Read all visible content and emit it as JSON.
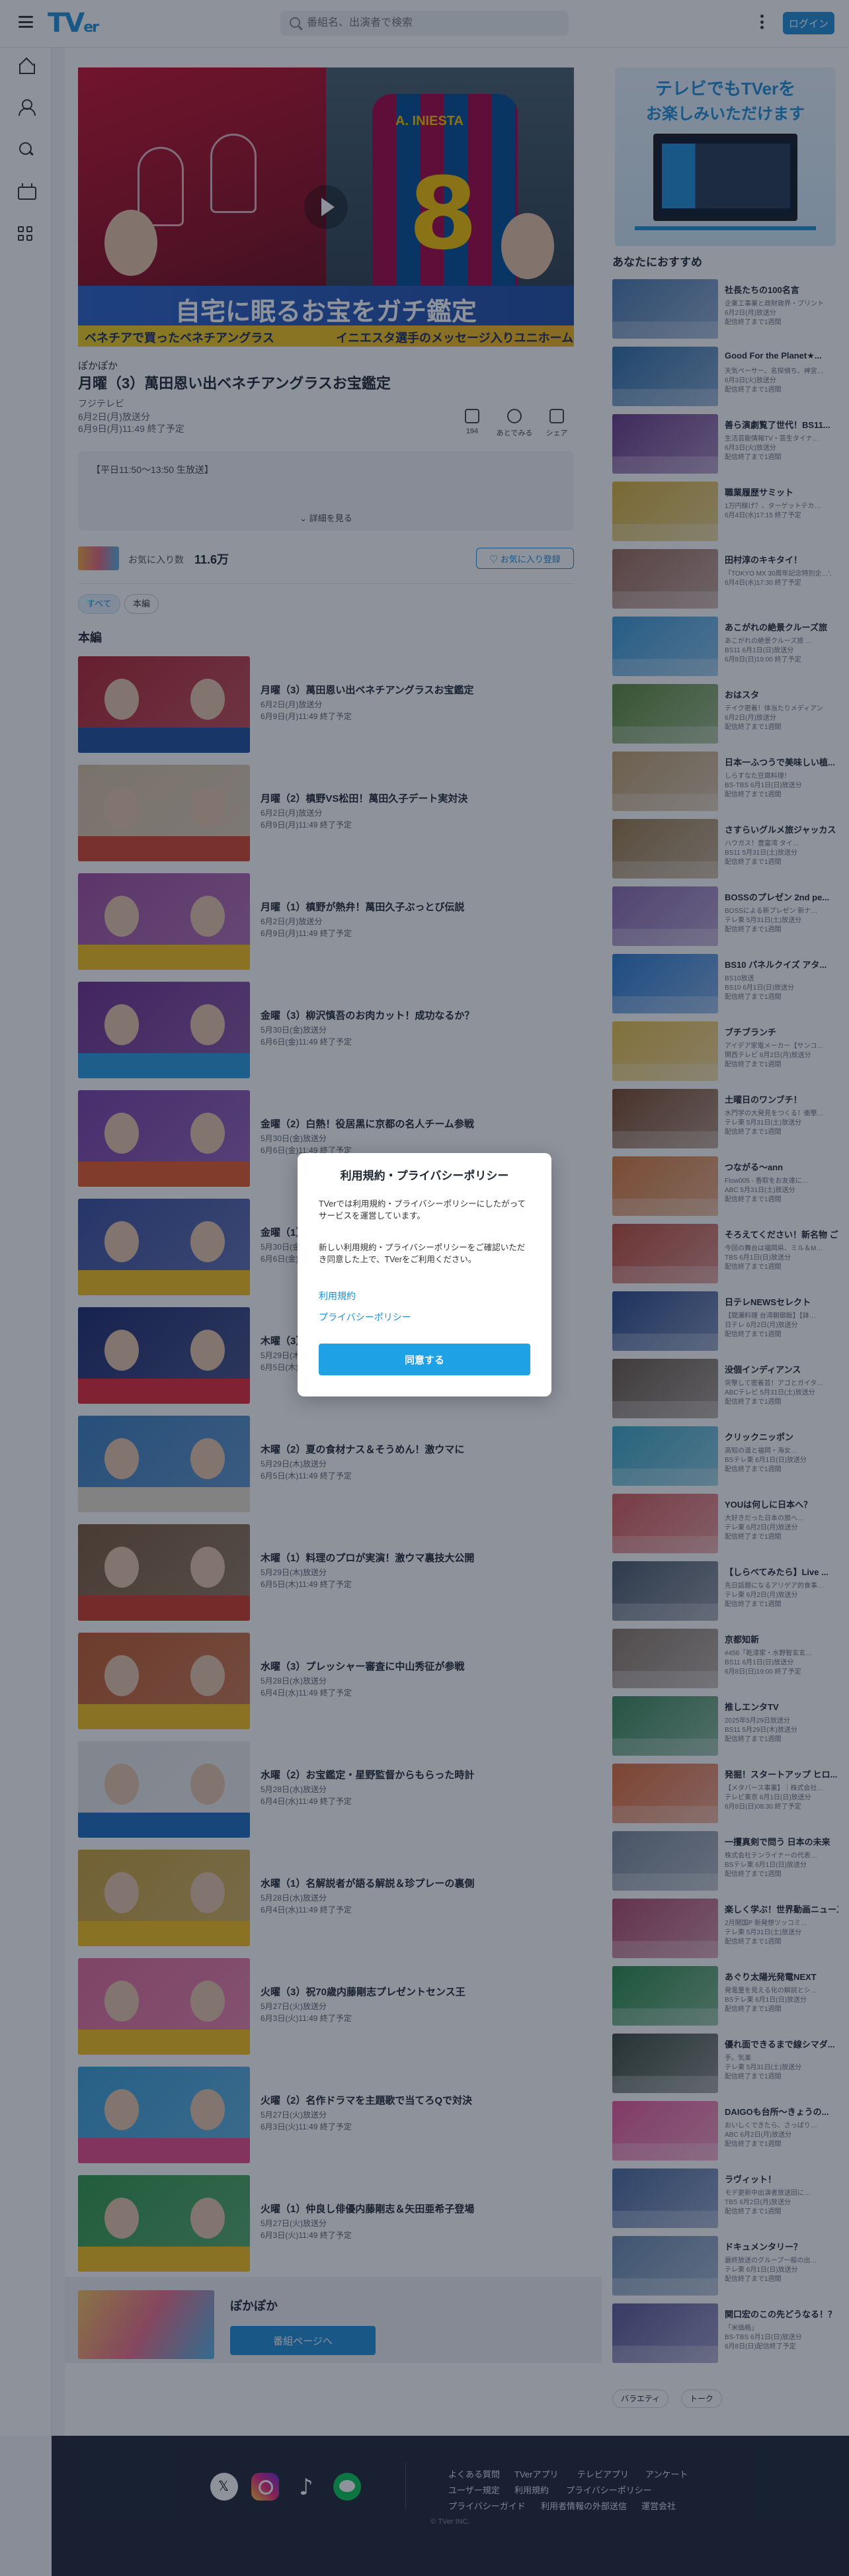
{
  "header": {
    "logo_main": "TV",
    "logo_sub": "er",
    "search_placeholder": "番組名、出演者で検索",
    "login_label": "ログイン"
  },
  "hero": {
    "overlay_text_left": "ベネチアで買ったベネチアングラス",
    "overlay_text_right": "イニエスタ選手のメッセージ入りユニホーム",
    "headline": "自宅に眠るお宝をガチ鑑定",
    "jersey_name": "A. INIESTA",
    "jersey_number": "8"
  },
  "episode": {
    "series": "ぽかぽか",
    "title": "月曜（3）萬田恩い出ベネチアングラスお宝鑑定",
    "broadcaster": "フジテレビ",
    "aired": "6月2日(月)放送分",
    "expires": "6月9日(月)11:49 終了予定",
    "description": "【平日11:50〜13:50 生放送】",
    "more_label": "詳細を見る",
    "actions": [
      {
        "label": "194"
      },
      {
        "label": "あとでみる"
      },
      {
        "label": "シェア"
      }
    ]
  },
  "favorites": {
    "label": "お気に入り数",
    "count": "11.6万",
    "button_label": "お気に入り登録"
  },
  "filters": {
    "all": "すべて",
    "main": "本編"
  },
  "section_title": "本編",
  "episodes": [
    {
      "title": "月曜（3）萬田恩い出ベネチアングラスお宝鑑定",
      "aired": "6月2日(月)放送分",
      "expires": "6月9日(月)11:49 終了予定"
    },
    {
      "title": "月曜（2）槙野VS松田！萬田久子デート実対決",
      "aired": "6月2日(月)放送分",
      "expires": "6月9日(月)11:49 終了予定"
    },
    {
      "title": "月曜（1）槙野が熱弁！萬田久子ぶっとび伝説",
      "aired": "6月2日(月)放送分",
      "expires": "6月9日(月)11:49 終了予定"
    },
    {
      "title": "金曜（3）柳沢慎吾のお肉カット！成功なるか？",
      "aired": "5月30日(金)放送分",
      "expires": "6月6日(金)11:49 終了予定"
    },
    {
      "title": "金曜（2）白熱！役居黒に京都の名人チーム参戦",
      "aired": "5月30日(金)放送分",
      "expires": "6月6日(金)11:49 終了予定"
    },
    {
      "title": "金曜（1）",
      "aired": "5月30日(金)放送分",
      "expires": "6月6日(金)11:49 終了予定"
    },
    {
      "title": "木曜（3）",
      "aired": "5月29日(木)放送分",
      "expires": "6月5日(木)11:49 終了予定"
    },
    {
      "title": "木曜（2）夏の食材ナス＆そうめん！激ウマに",
      "aired": "5月29日(木)放送分",
      "expires": "6月5日(木)11:49 終了予定"
    },
    {
      "title": "木曜（1）料理のプロが実演！激ウマ裏技大公開",
      "aired": "5月29日(木)放送分",
      "expires": "6月5日(木)11:49 終了予定"
    },
    {
      "title": "水曜（3）プレッシャー審査に中山秀征が参戦",
      "aired": "5月28日(水)放送分",
      "expires": "6月4日(水)11:49 終了予定"
    },
    {
      "title": "水曜（2）お宝鑑定・星野監督からもらった時計",
      "aired": "5月28日(水)放送分",
      "expires": "6月4日(水)11:49 終了予定"
    },
    {
      "title": "水曜（1）名解説者が語る解説＆珍プレーの裏側",
      "aired": "5月28日(水)放送分",
      "expires": "6月4日(水)11:49 終了予定"
    },
    {
      "title": "火曜（3）祝70歳内藤剛志プレゼントセンス王",
      "aired": "5月27日(火)放送分",
      "expires": "6月3日(火)11:49 終了予定"
    },
    {
      "title": "火曜（2）名作ドラマを主題歌で当てろQで対決",
      "aired": "5月27日(火)放送分",
      "expires": "6月3日(火)11:49 終了予定"
    },
    {
      "title": "火曜（1）仲良し俳優内藤剛志＆矢田亜希子登場",
      "aired": "5月27日(火)放送分",
      "expires": "6月3日(火)11:49 終了予定"
    }
  ],
  "series_card": {
    "name": "ぽかぽか",
    "button_label": "番組ページへ"
  },
  "promo": {
    "line1": "テレビでもTVerを",
    "line2": "お楽しみいただけます"
  },
  "side_title": "あなたにおすすめ",
  "recommended": [
    {
      "title": "社長たちの100名言",
      "sub": "企業工事業と政財政界・プリント",
      "d1": "6月2日(月)放送分",
      "d2": "配信終了まで1週間"
    },
    {
      "title": "Good For the Planet★...",
      "sub": "天気ペーサー、名探偵ち、神宮…",
      "d1": "6月3日(火)放送分",
      "d2": "配信終了まで1週間"
    },
    {
      "title": "善ら演劇覧了世代！BS11...",
      "sub": "生活芸能情報TV・芸生タイナ…",
      "d1": "6月3日(火)放送分",
      "d2": "配信終了まで1週間"
    },
    {
      "title": "職業履歴サミット",
      "sub": "1万円稼げ？、ターゲットテカ…",
      "d1": "6月4日(水)17:15 終了予定",
      "d2": ""
    },
    {
      "title": "田村淳のキキタイ！",
      "sub": "『TOKYO MX 30周年記念特別企…', ",
      "d1": "6月4日(水)17:30 終了予定",
      "d2": ""
    },
    {
      "title": "あこがれの絶景クルーズ旅",
      "sub": "あこがれの絶景クルーズ旅 …",
      "d1": "BS11 6月1日(日)放送分",
      "d2": "6月8日(日)19:00 終了予定"
    },
    {
      "title": "おはスタ",
      "sub": "テイク密着！体当たりメディアン",
      "d1": "6月2日(月)放送分",
      "d2": "配信終了まで1週間"
    },
    {
      "title": "日本一ふつうで美味しい植...",
      "sub": "しらすなた豆腐料理！",
      "d1": "BS-TBS 6月1日(日)放送分",
      "d2": "配信終了まで1週間"
    },
    {
      "title": "さすらいグルメ旅ジャッカス",
      "sub": "ハウガス！豊富湾 タイ…",
      "d1": "BS11 5月31日(土)放送分",
      "d2": "配信終了まで1週間"
    },
    {
      "title": "BOSSのプレゼン 2nd pe...",
      "sub": "BOSSによる新プレゼン 新ナ…",
      "d1": "テレ東 5月31日(土)放送分",
      "d2": "配信終了まで1週間"
    },
    {
      "title": "BS10 パネルクイズ アタ...",
      "sub": "BS10放送",
      "d1": "BS10 6月1日(日)放送分",
      "d2": "配信終了まで1週間"
    },
    {
      "title": "ブチブランチ",
      "sub": "アイデア家電メーカー【サンコ…",
      "d1": "関西テレビ 6月2日(月)放送分",
      "d2": "配信終了まで1週間"
    },
    {
      "title": "土曜日のワンブチ！",
      "sub": "水門学の大発見をつくる！衝撃…",
      "d1": "テレ東 5月31日(土)放送分",
      "d2": "配信終了まで1週間"
    },
    {
      "title": "つながる〜ann",
      "sub": "Flow005 - 香取をお友達に…",
      "d1": "ABC 5月31日(土)放送分",
      "d2": "配信終了まで1週間"
    },
    {
      "title": "そろえてください！新名物 ご...",
      "sub": "今回の舞台は福岡県、ミル＆M…",
      "d1": "TBS 6月1日(日)放送分",
      "d2": "配信終了まで1週間"
    },
    {
      "title": "日テレNEWSセレクト",
      "sub": "【間瀬料理 台湾朝御飯】【鉢…",
      "d1": "日テレ 6月2日(月)放送分",
      "d2": "配信終了まで1週間"
    },
    {
      "title": "没個インディアンス",
      "sub": "突撃して密着芸！アゴとガイタ…",
      "d1": "ABCテレビ 5月31日(土)放送分",
      "d2": "配信終了まで1週間"
    },
    {
      "title": "クリックニッポン",
      "sub": "高知の道と福岡・海女…",
      "d1": "BSテレ東 6月1日(日)放送分",
      "d2": "配信終了まで1週間"
    },
    {
      "title": "YOUは何しに日本へ？",
      "sub": "大好きだった日本の旅へ…",
      "d1": "テレ東 6月2日(月)放送分",
      "d2": "配信終了まで1週間"
    },
    {
      "title": "【しらべてみたら】Live ...",
      "sub": "先日話題になるアリゲア的食事…",
      "d1": "テレ東 6月2日(月)放送分",
      "d2": "配信終了まで1週間"
    },
    {
      "title": "京都知新",
      "sub": "#456「乾漆家・水野智玄玄…",
      "d1": "BS11 6月1日(日)放送分",
      "d2": "6月8日(日)19:00 終了予定"
    },
    {
      "title": "推しエンタTV",
      "sub": "2025年5月29日放送分",
      "d1": "BS11 5月29日(木)放送分",
      "d2": "配信終了まで1週間"
    },
    {
      "title": "発掘！スタートアップ ヒロ...",
      "sub": "【メタバース事業】｜株式会社…",
      "d1": "テレビ東京 6月1日(日)放送分",
      "d2": "6月8日(日)08:30 終了予定"
    },
    {
      "title": "一攫真剣で問う 日本の未来",
      "sub": "株式会社テンライナーの代表…",
      "d1": "BSテレ東 6月1日(日)放送分",
      "d2": "配信終了まで1週間"
    },
    {
      "title": "楽しく学ぶ！世界動画ニュース",
      "sub": "2月開国P 新発想ツッコミ…",
      "d1": "テレ東 5月31日(土)放送分",
      "d2": "配信終了まで1週間"
    },
    {
      "title": "あぐり太陽光発電NEXT",
      "sub": "発電量を見える化の解説とシ…",
      "d1": "BSテレ東 6月1日(日)放送分",
      "d2": "配信終了まで1週間"
    },
    {
      "title": "優れ面できるまで線シマダ...",
      "sub": "手。気楽",
      "d1": "テレ東 5月31日(土)放送分",
      "d2": "配信終了まで1週間"
    },
    {
      "title": "DAIGOも台所〜きょうの...",
      "sub": "おいしくできたら、さっぱり…",
      "d1": "ABC 6月2日(月)放送分",
      "d2": "配信終了まで1週間"
    },
    {
      "title": "ラヴィット！",
      "sub": "モデ更新中出演者放送回に…",
      "d1": "TBS 6月2日(月)放送分",
      "d2": "配信終了まで1週間"
    },
    {
      "title": "ドキュメンタリー？",
      "sub": "最終放送のグループ一般の出…",
      "d1": "テレ東 6月1日(日)放送分",
      "d2": "配信終了まで1週間"
    },
    {
      "title": "関口宏のこの先どうなる！？",
      "sub": "「米価格」",
      "d1": "BS-TBS 6月1日(日)放送分",
      "d2": "6月8日(日)配信終了予定"
    }
  ],
  "tags": [
    "バラエティ",
    "トーク"
  ],
  "footer": {
    "links_row1": [
      "よくある質問",
      "TVerアプリ",
      "テレビアプリ",
      "アンケート"
    ],
    "links_row2": [
      "ユーザー規定",
      "利用規約",
      "プライバシーポリシー"
    ],
    "links_row3": [
      "プライバシーガイド",
      "利用者情報の外部送信",
      "運営会社"
    ],
    "copyright": "© TVer INC."
  },
  "modal": {
    "title": "利用規約・プライバシーポリシー",
    "para1": "TVerでは利用規約・プライバシーポリシーにしたがってサービスを運営しています。",
    "para2": "新しい利用規約・プライバシーポリシーをご確認いただき同意した上で、TVerをご利用ください。",
    "link_terms": "利用規約",
    "link_privacy": "プライバシーポリシー",
    "agree_label": "同意する"
  },
  "colors": {
    "accent": "#1e8fd6",
    "footer": "#1d2535"
  }
}
